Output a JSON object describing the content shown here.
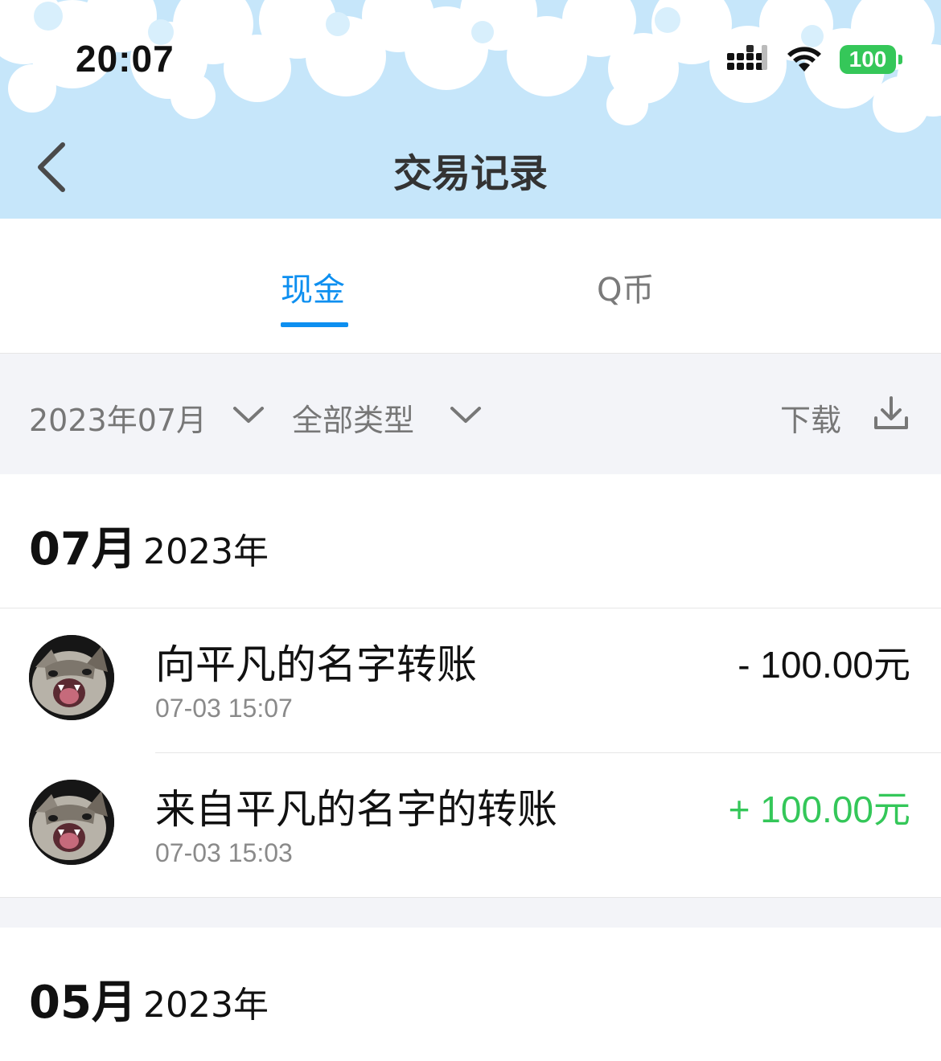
{
  "status_bar": {
    "time": "20:07",
    "battery": "100",
    "icons": [
      "signal-icon",
      "wifi-icon",
      "battery-icon"
    ]
  },
  "header": {
    "title": "交易记录",
    "back_icon": "chevron-left-icon"
  },
  "tabs": [
    {
      "label": "现金",
      "active": true
    },
    {
      "label": "Q币",
      "active": false
    }
  ],
  "filters": {
    "date": "2023年07月",
    "type": "全部类型",
    "download_label": "下载",
    "download_icon": "download-icon"
  },
  "colors": {
    "accent": "#0d8ff0",
    "income": "#34c759",
    "header_bg": "#c6e6fa",
    "filter_bg": "#f3f4f8"
  },
  "months": [
    {
      "month": "07月",
      "year": "2023年",
      "transactions": [
        {
          "title": "向平凡的名字转账",
          "time": "07-03 15:07",
          "amount": "- 100.00元",
          "direction": "out"
        },
        {
          "title": "来自平凡的名字的转账",
          "time": "07-03 15:03",
          "amount": "+ 100.00元",
          "direction": "in"
        }
      ]
    },
    {
      "month": "05月",
      "year": "2023年",
      "transactions": []
    }
  ]
}
